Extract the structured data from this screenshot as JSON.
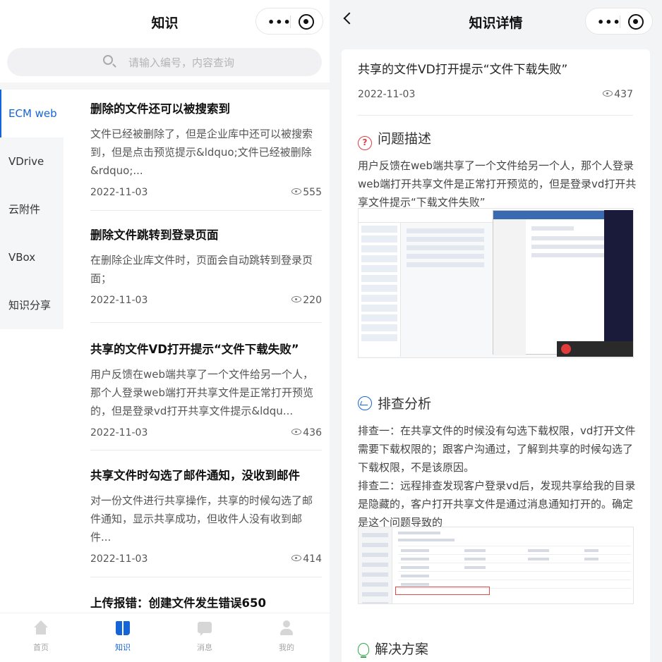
{
  "left": {
    "header": {
      "title": "知识"
    },
    "search": {
      "placeholder": "请输入编号，内容查询"
    },
    "categories": [
      {
        "label": "ECM web",
        "active": true
      },
      {
        "label": "VDrive",
        "active": false
      },
      {
        "label": "云附件",
        "active": false
      },
      {
        "label": "VBox",
        "active": false
      },
      {
        "label": "知识分享",
        "active": false
      }
    ],
    "articles": [
      {
        "title": "删除的文件还可以被搜索到",
        "summary": "文件已经被删除了，但是企业库中还可以被搜索到，但是点击预览提示&ldquo;文件已经被删除&rdquo;...",
        "date": "2022-11-03",
        "views": "555"
      },
      {
        "title": "删除文件跳转到登录页面",
        "summary": "在删除企业库文件时，页面会自动跳转到登录页面；",
        "date": "2022-11-03",
        "views": "220"
      },
      {
        "title": "共享的文件VD打开提示“文件下载失败”",
        "summary": "用户反馈在web端共享了一个文件给另一个人，那个人登录web端打开共享文件是正常打开预览的，但是登录vd打开共享文件提示&ldqu...",
        "date": "2022-11-03",
        "views": "436"
      },
      {
        "title": "共享文件时勾选了邮件通知，没收到邮件",
        "summary": "对一份文件进行共享操作，共享的时候勾选了邮件通知，显示共享成功，但收件人没有收到邮件...",
        "date": "2022-11-03",
        "views": "414"
      },
      {
        "title": "上传报错：创建文件发生错误650"
      }
    ],
    "tabbar": [
      {
        "label": "首页",
        "icon": "home-icon",
        "active": false
      },
      {
        "label": "知识",
        "icon": "book-icon",
        "active": true
      },
      {
        "label": "消息",
        "icon": "message-icon",
        "active": false
      },
      {
        "label": "我的",
        "icon": "user-icon",
        "active": false
      }
    ]
  },
  "right": {
    "header": {
      "title": "知识详情"
    },
    "article": {
      "title": "共享的文件VD打开提示“文件下载失败”",
      "date": "2022-11-03",
      "views": "437",
      "sections": {
        "problem": {
          "heading": "问题描述",
          "text": "用户反馈在web端共享了一个文件给另一个人，那个人登录web端打开共享文件是正常打开预览的，但是登录vd打开共享文件提示“下载文件失败”"
        },
        "analysis": {
          "heading": "排查分析",
          "text": "排查一：在共享文件的时候没有勾选下载权限，vd打开文件需要下载权限的；跟客户沟通过，了解到共享的时候勾选了下载权限，不是该原因。",
          "text2": "排查二：远程排查发现客户登录vd后，发现共享给我的目录是隐藏的，客户打开共享文件是通过消息通知打开的。确定是这个问题导致的"
        },
        "solution": {
          "heading": "解决方案"
        }
      }
    }
  },
  "colors": {
    "accent": "#1565d8",
    "problem_icon": "#e04040",
    "solution_icon": "#2eaa4a"
  }
}
